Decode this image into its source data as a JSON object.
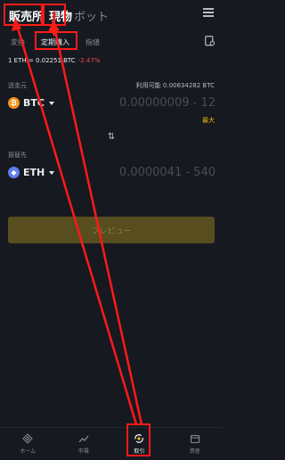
{
  "top_tabs": [
    {
      "label": "販売所"
    },
    {
      "label": "現物"
    },
    {
      "label": "ボット"
    }
  ],
  "sub_tabs": [
    {
      "label": "変換"
    },
    {
      "label": "定期購入"
    },
    {
      "label": "指値"
    }
  ],
  "rate": {
    "text": "1 ETH = 0.02251 BTC",
    "change": "-2.47%"
  },
  "from": {
    "label": "送金元",
    "available": "利用可能 0.00634282 BTC",
    "coin": "BTC",
    "placeholder": "0.00000009 - 12",
    "max_label": "最大"
  },
  "to": {
    "label": "振替先",
    "coin": "ETH",
    "placeholder": "0.0000041 - 540"
  },
  "preview_button": "プレビュー",
  "nav": [
    {
      "label": "ホーム",
      "icon": "home-icon"
    },
    {
      "label": "市場",
      "icon": "market-icon"
    },
    {
      "label": "取引",
      "icon": "trade-icon"
    },
    {
      "label": "資産",
      "icon": "wallet-icon"
    }
  ],
  "colors": {
    "background": "#16191f",
    "accent": "#f0b90b",
    "negative": "#f6465d",
    "annotation": "#ff1a1a"
  }
}
